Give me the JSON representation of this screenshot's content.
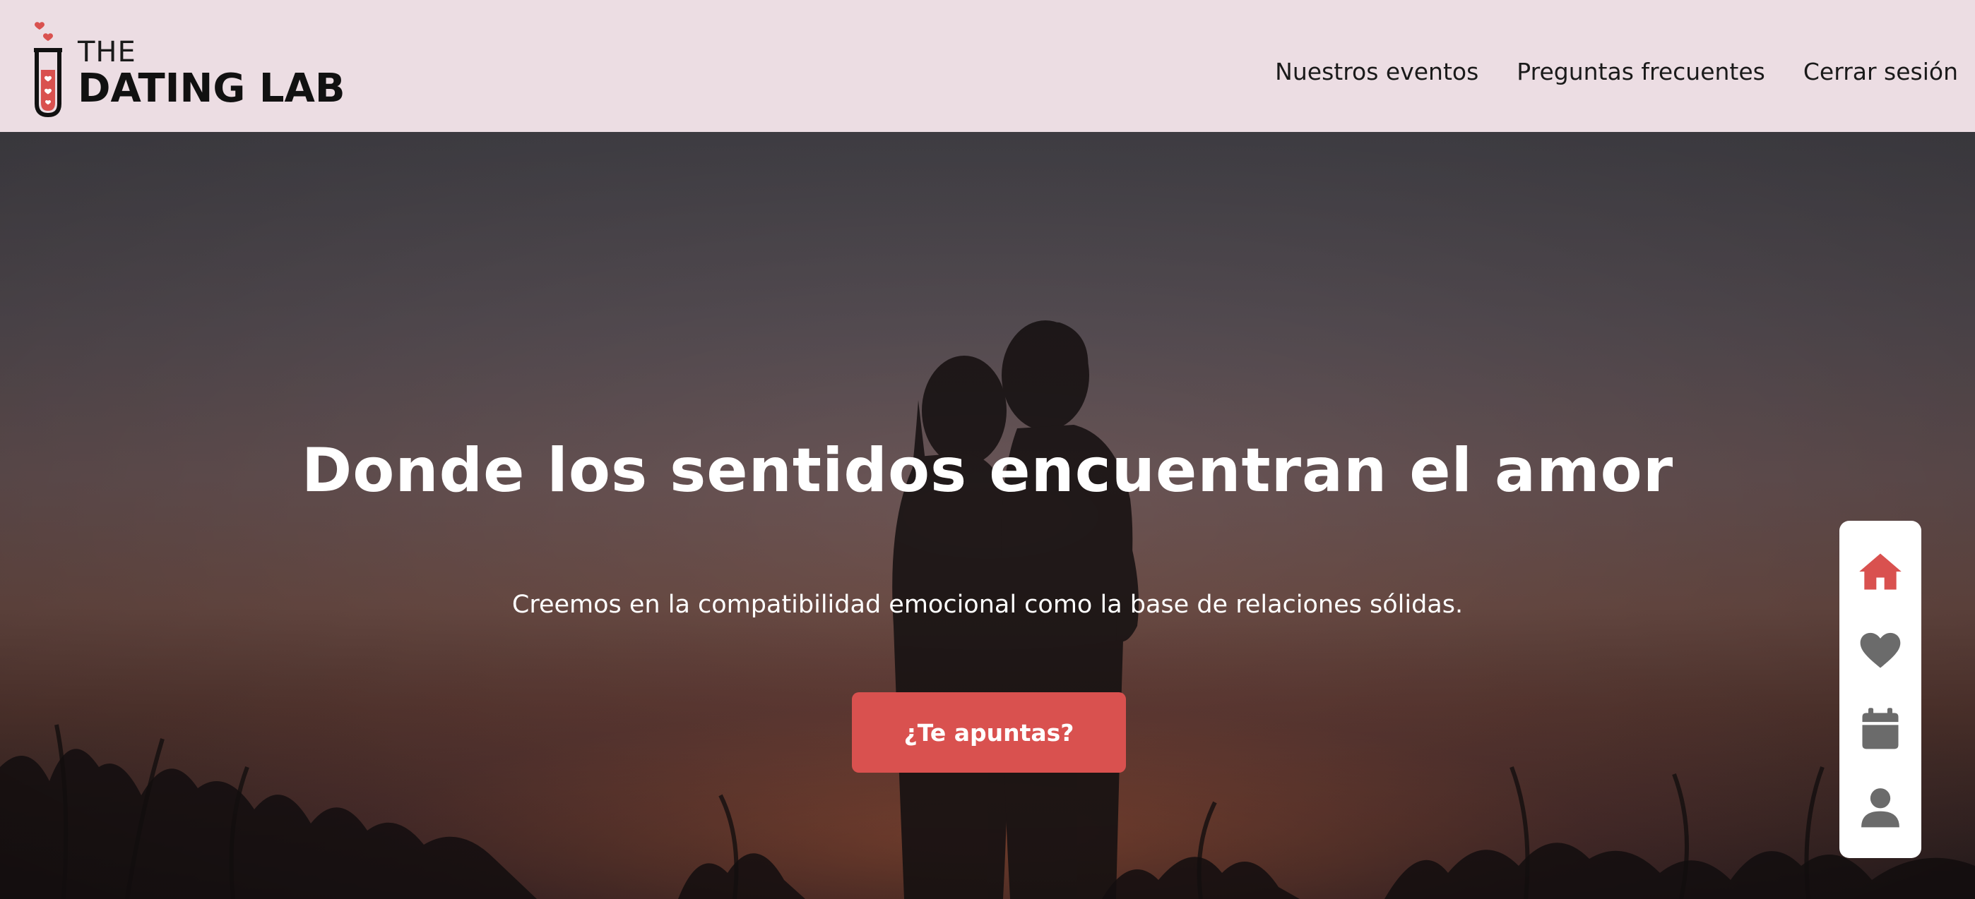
{
  "header": {
    "logo": {
      "line1": "THE",
      "line2": "DATING LAB",
      "icon": "test-tube-hearts-icon"
    },
    "nav": [
      {
        "label": "Nuestros eventos"
      },
      {
        "label": "Preguntas frecuentes"
      },
      {
        "label": "Cerrar sesión"
      }
    ]
  },
  "hero": {
    "title": "Donde los sentidos encuentran el amor",
    "subtitle": "Creemos en la compatibilidad emocional como la base de relaciones sólidas.",
    "cta_label": "¿Te apuntas?"
  },
  "sidenav": {
    "items": [
      {
        "icon": "home-icon",
        "active": true
      },
      {
        "icon": "heart-icon",
        "active": false
      },
      {
        "icon": "calendar-icon",
        "active": false
      },
      {
        "icon": "user-icon",
        "active": false
      }
    ]
  },
  "colors": {
    "accent": "#d9514f",
    "header_bg": "#ecdde3",
    "icon_inactive": "#6b6b6b"
  }
}
